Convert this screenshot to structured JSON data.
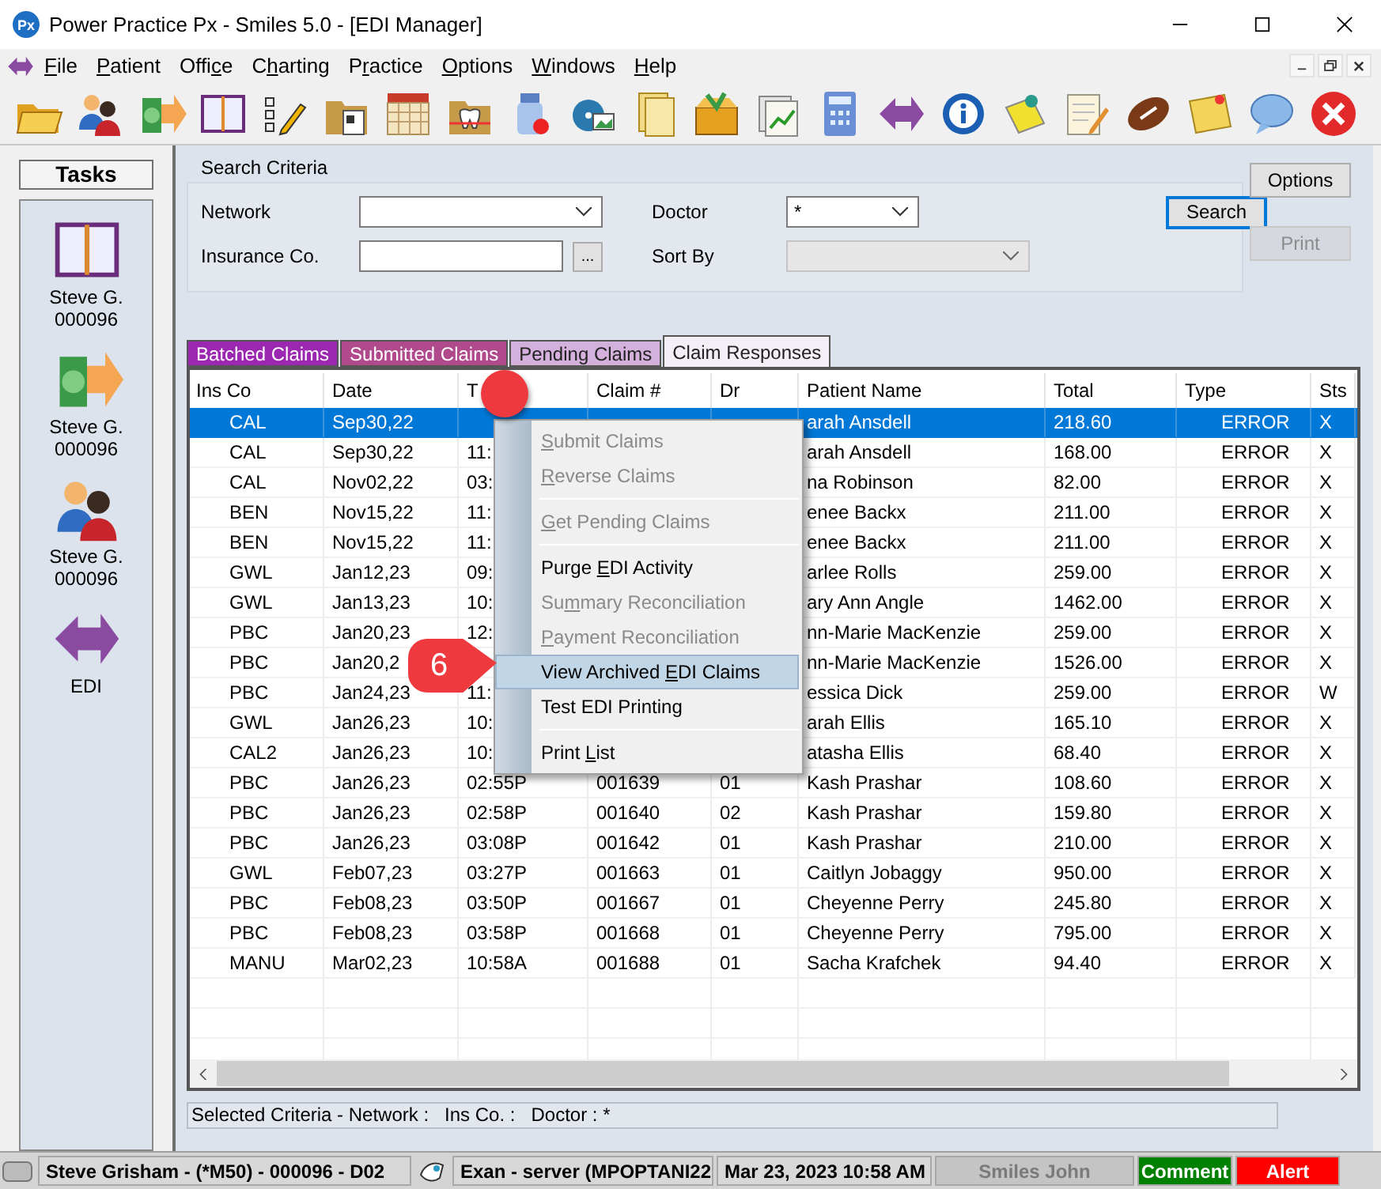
{
  "window": {
    "app_icon": "Px",
    "title": "Power Practice Px - Smiles 5.0 - [EDI Manager]"
  },
  "menu": [
    {
      "key": "F",
      "post": "ile"
    },
    {
      "key": "P",
      "post": "atient"
    },
    {
      "pre": "Offi",
      "key": "c",
      "post": "e"
    },
    {
      "pre": "C",
      "key": "h",
      "post": "arting"
    },
    {
      "pre": "P",
      "key": "r",
      "post": "actice"
    },
    {
      "key": "O",
      "post": "ptions"
    },
    {
      "key": "W",
      "post": "indows"
    },
    {
      "key": "H",
      "post": "elp"
    }
  ],
  "tasks": {
    "title": "Tasks",
    "items": [
      {
        "label": "Steve G.",
        "number": "000096"
      },
      {
        "label": "Steve G.",
        "number": "000096"
      },
      {
        "label": "Steve G.",
        "number": "000096"
      },
      {
        "label": "EDI"
      }
    ]
  },
  "search": {
    "title": "Search Criteria",
    "network_label": "Network",
    "insurance_label": "Insurance Co.",
    "browse_button": "...",
    "doctor_label": "Doctor",
    "doctor_value": "*",
    "sort_label": "Sort By",
    "search_button": "Search"
  },
  "side_buttons": [
    {
      "label": "Options",
      "disabled": false
    },
    {
      "label": "Print",
      "disabled": true
    }
  ],
  "tabs": [
    {
      "label": "Batched Claims",
      "color": "#9c27b0",
      "selected": false
    },
    {
      "label": "Submitted Claims",
      "color": "#b04a8c",
      "selected": false
    },
    {
      "label": "Pending Claims",
      "color": "#d4b0dc",
      "selected": false
    },
    {
      "label": "Claim Responses",
      "color": "#f4eef6",
      "selected": true
    }
  ],
  "table": {
    "columns": [
      "Ins Co",
      "Date",
      "T",
      "Claim #",
      "Dr",
      "Patient Name",
      "Total",
      "Type",
      "Sts"
    ],
    "rows": [
      {
        "ins": "CAL",
        "date": "Sep30,22",
        "patient": "arah Ansdell",
        "total": "218.60",
        "type": "ERROR",
        "sts": "X",
        "selected": true
      },
      {
        "ins": "CAL",
        "date": "Sep30,22",
        "time": "11:",
        "patient": "arah Ansdell",
        "total": "168.00",
        "type": "ERROR",
        "sts": "X",
        "selected": false
      },
      {
        "ins": "CAL",
        "date": "Nov02,22",
        "time": "03:",
        "patient": "na Robinson",
        "total": "82.00",
        "type": "ERROR",
        "sts": "X",
        "selected": false
      },
      {
        "ins": "BEN",
        "date": "Nov15,22",
        "time": "11:",
        "patient": "enee Backx",
        "total": "211.00",
        "type": "ERROR",
        "sts": "X",
        "selected": false
      },
      {
        "ins": "BEN",
        "date": "Nov15,22",
        "time": "11:",
        "patient": "enee Backx",
        "total": "211.00",
        "type": "ERROR",
        "sts": "X",
        "selected": false
      },
      {
        "ins": "GWL",
        "date": "Jan12,23",
        "time": "09:",
        "patient": "arlee Rolls",
        "total": "259.00",
        "type": "ERROR",
        "sts": "X",
        "selected": false
      },
      {
        "ins": "GWL",
        "date": "Jan13,23",
        "time": "10:",
        "patient": "ary Ann Angle",
        "total": "1462.00",
        "type": "ERROR",
        "sts": "X",
        "selected": false
      },
      {
        "ins": "PBC",
        "date": "Jan20,23",
        "time": "12:",
        "patient": "nn-Marie MacKenzie",
        "total": "259.00",
        "type": "ERROR",
        "sts": "X",
        "selected": false
      },
      {
        "ins": "PBC",
        "date": "Jan20,2",
        "patient": "nn-Marie MacKenzie",
        "total": "1526.00",
        "type": "ERROR",
        "sts": "X",
        "selected": false
      },
      {
        "ins": "PBC",
        "date": "Jan24,23",
        "time": "11:",
        "patient": "essica Dick",
        "total": "259.00",
        "type": "ERROR",
        "sts": "W",
        "selected": false
      },
      {
        "ins": "GWL",
        "date": "Jan26,23",
        "time": "10:",
        "patient": "arah Ellis",
        "total": "165.10",
        "type": "ERROR",
        "sts": "X",
        "selected": false
      },
      {
        "ins": "CAL2",
        "date": "Jan26,23",
        "time": "10:",
        "patient": "atasha Ellis",
        "total": "68.40",
        "type": "ERROR",
        "sts": "X",
        "selected": false
      },
      {
        "ins": "PBC",
        "date": "Jan26,23",
        "time": "02:55P",
        "claim": "001639",
        "dr": "01",
        "patient": "Kash Prashar",
        "total": "108.60",
        "type": "ERROR",
        "sts": "X",
        "selected": false
      },
      {
        "ins": "PBC",
        "date": "Jan26,23",
        "time": "02:58P",
        "claim": "001640",
        "dr": "02",
        "patient": "Kash Prashar",
        "total": "159.80",
        "type": "ERROR",
        "sts": "X",
        "selected": false
      },
      {
        "ins": "PBC",
        "date": "Jan26,23",
        "time": "03:08P",
        "claim": "001642",
        "dr": "01",
        "patient": "Kash Prashar",
        "total": "210.00",
        "type": "ERROR",
        "sts": "X",
        "selected": false
      },
      {
        "ins": "GWL",
        "date": "Feb07,23",
        "time": "03:27P",
        "claim": "001663",
        "dr": "01",
        "patient": "Caitlyn Jobaggy",
        "total": "950.00",
        "type": "ERROR",
        "sts": "X",
        "selected": false
      },
      {
        "ins": "PBC",
        "date": "Feb08,23",
        "time": "03:50P",
        "claim": "001667",
        "dr": "01",
        "patient": "Cheyenne Perry",
        "total": "245.80",
        "type": "ERROR",
        "sts": "X",
        "selected": false
      },
      {
        "ins": "PBC",
        "date": "Feb08,23",
        "time": "03:58P",
        "claim": "001668",
        "dr": "01",
        "patient": "Cheyenne Perry",
        "total": "795.00",
        "type": "ERROR",
        "sts": "X",
        "selected": false
      },
      {
        "ins": "MANU",
        "date": "Mar02,23",
        "time": "10:58A",
        "claim": "001688",
        "dr": "01",
        "patient": "Sacha Krafchek",
        "total": "94.40",
        "type": "ERROR",
        "sts": "X",
        "selected": false
      }
    ]
  },
  "context_menu": [
    {
      "kind": "item",
      "key": "S",
      "post": "ubmit Claims",
      "disabled": true,
      "selected": false
    },
    {
      "kind": "item",
      "key": "R",
      "post": "everse Claims",
      "disabled": true,
      "selected": false
    },
    {
      "kind": "separator"
    },
    {
      "kind": "item",
      "key": "G",
      "post": "et Pending Claims",
      "disabled": true,
      "selected": false
    },
    {
      "kind": "separator"
    },
    {
      "kind": "item",
      "pre": "Purge ",
      "key": "E",
      "post": "DI Activity",
      "disabled": false,
      "selected": false
    },
    {
      "kind": "item",
      "pre": "Su",
      "key": "m",
      "post": "mary Reconciliation",
      "disabled": true,
      "selected": false
    },
    {
      "kind": "item",
      "key": "P",
      "post": "ayment Reconciliation",
      "disabled": true,
      "selected": false
    },
    {
      "kind": "item",
      "pre": "View Archived ",
      "key": "E",
      "post": "DI Claims",
      "disabled": false,
      "selected": true
    },
    {
      "kind": "item",
      "pre": "Test EDI Printing",
      "disabled": false,
      "selected": false
    },
    {
      "kind": "separator"
    },
    {
      "kind": "item",
      "pre": "Print ",
      "key": "L",
      "post": "ist",
      "disabled": false,
      "selected": false
    }
  ],
  "annotations": [
    {
      "kind": "dot"
    },
    {
      "kind": "callout",
      "label": "6"
    }
  ],
  "selected_criteria": "Selected Criteria - Network :   Ins Co. :   Doctor : *",
  "status_bar": [
    {
      "kind": "user",
      "text": "Steve Grisham - (*M50) - 000096 - D02"
    },
    {
      "kind": "server",
      "text": "Exan - server (MPOPTANI22"
    },
    {
      "kind": "date",
      "text": "Mar 23, 2023 10:58 AM"
    },
    {
      "kind": "muted",
      "text": "Smiles John"
    },
    {
      "kind": "comment",
      "text": "Comment"
    },
    {
      "kind": "alert",
      "text": "Alert"
    }
  ]
}
